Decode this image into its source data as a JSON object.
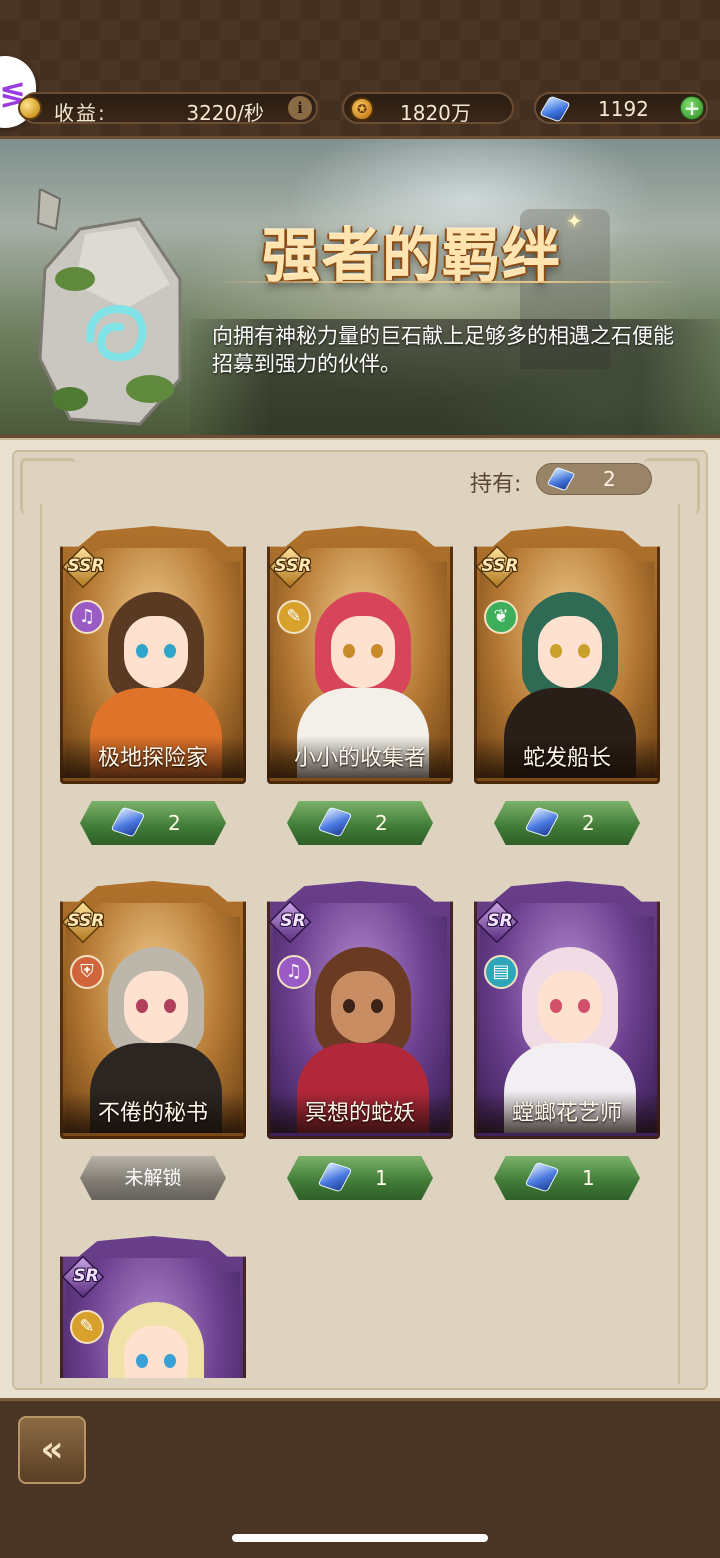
{
  "topbar": {
    "income_label": "收益:",
    "income_value": "3220/秒",
    "info_icon": "i",
    "gold_value": "1820万",
    "gem_value": "1192",
    "plus_icon": "+"
  },
  "banner": {
    "title": "强者的羁绊",
    "description": "向拥有神秘力量的巨石献上足够多的相遇之石便能招募到强力的伙伴。"
  },
  "holding": {
    "label": "持有:",
    "value": "2"
  },
  "cards": [
    {
      "name": "极地探险家",
      "rarity": "SSR",
      "class_icon": "harp-icon",
      "cost": "2",
      "status": "cost"
    },
    {
      "name": "小小的收集者",
      "rarity": "SSR",
      "class_icon": "broom-icon",
      "cost": "2",
      "status": "cost"
    },
    {
      "name": "蛇发船长",
      "rarity": "SSR",
      "class_icon": "wing-icon",
      "cost": "2",
      "status": "cost"
    },
    {
      "name": "不倦的秘书",
      "rarity": "SSR",
      "class_icon": "shield-icon",
      "locked_label": "未解锁",
      "status": "locked"
    },
    {
      "name": "冥想的蛇妖",
      "rarity": "SR",
      "class_icon": "harp-icon",
      "cost": "1",
      "status": "cost"
    },
    {
      "name": "螳螂花艺师",
      "rarity": "SR",
      "class_icon": "book-icon",
      "cost": "1",
      "status": "cost"
    },
    {
      "name": "",
      "rarity": "SR",
      "class_icon": "broom-icon",
      "status": "partial"
    }
  ],
  "colors": {
    "ssr": "#b0722c",
    "sr": "#6a3f8a",
    "cost_button": "#3f7a36",
    "locked_button": "#7e7a72"
  },
  "icons": {
    "back": "back-arrow-icon",
    "gem": "gem-icon",
    "gold": "gold-coin-icon"
  }
}
